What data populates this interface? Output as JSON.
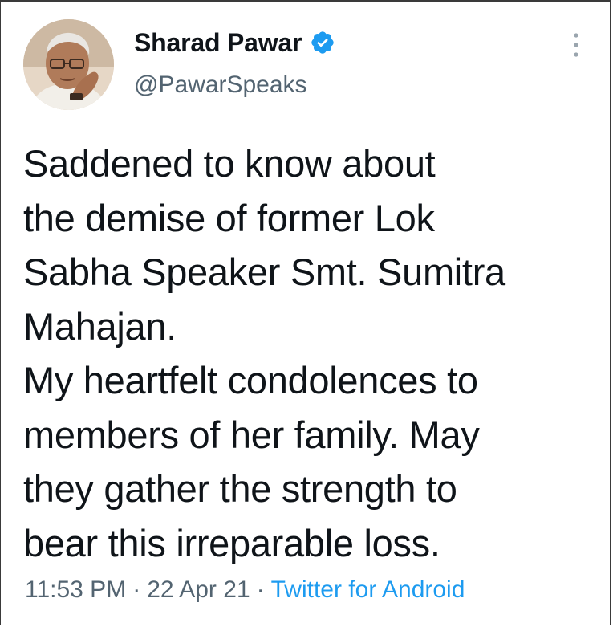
{
  "tweet": {
    "author": {
      "display_name": "Sharad Pawar",
      "handle": "@PawarSpeaks",
      "verified": true,
      "verified_icon": "verified-badge-icon",
      "avatar": "profile-photo"
    },
    "menu_icon": "more-options-icon",
    "text_lines": [
      "Saddened to know about",
      "the demise of former Lok",
      "Sabha Speaker Smt. Sumitra",
      "Mahajan.",
      "My heartfelt condolences to",
      "members of her family. May",
      "they gather the strength to",
      "bear this irreparable loss."
    ],
    "time": "11:53 PM",
    "separator": "·",
    "date": "22 Apr 21",
    "source": "Twitter for Android"
  },
  "colors": {
    "text": "#0f1419",
    "secondary": "#536471",
    "link": "#1d9bf0",
    "verified": "#1d9bf0",
    "background": "#ffffff"
  }
}
